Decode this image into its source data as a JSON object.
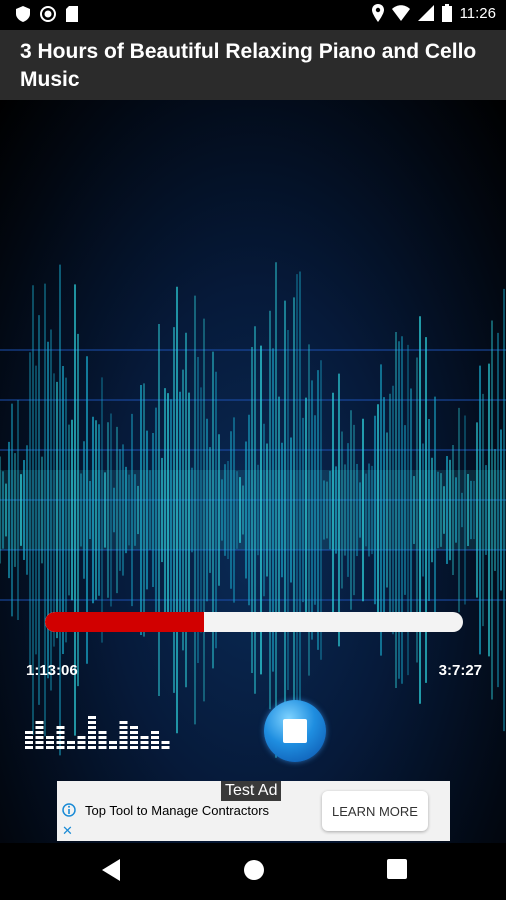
{
  "status_bar": {
    "time": "11:26"
  },
  "title": "3 Hours of Beautiful Relaxing Piano and Cello Music",
  "player": {
    "elapsed": "1:13:06",
    "total": "3:7:27",
    "progress_fraction": 0.38
  },
  "ad": {
    "label": "Test Ad",
    "text": "Top Tool to Manage Contractors",
    "button": "LEARN MORE"
  },
  "colors": {
    "progress_fill": "#d10000",
    "progress_track": "#f3f3f3",
    "title_bar": "#2b2b2b"
  }
}
